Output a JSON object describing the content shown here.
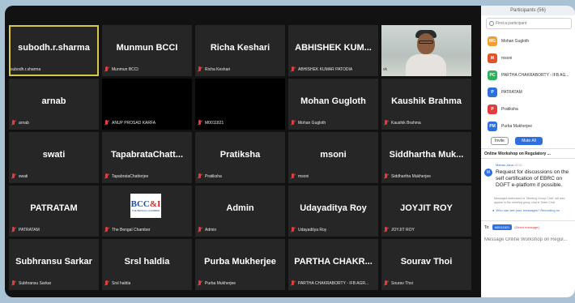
{
  "tiles": [
    {
      "big": "subodh.r.sharma",
      "foot": "subodh.r.sharma",
      "type": "name",
      "active": true,
      "mic": false
    },
    {
      "big": "Munmun BCCI",
      "foot": "Munmun BCCI",
      "type": "name",
      "mic": true
    },
    {
      "big": "Richa Keshari",
      "foot": "Richa Keshari",
      "type": "name",
      "mic": true
    },
    {
      "big": "ABHISHEK KUM...",
      "foot": "ABHISHEK KUMAR PATODIA",
      "type": "name",
      "mic": true
    },
    {
      "big": "",
      "foot": "",
      "type": "video",
      "mic": false
    },
    {
      "big": "arnab",
      "foot": "arnab",
      "type": "name",
      "mic": true
    },
    {
      "big": "",
      "foot": "ANUP PROSAD KARFA",
      "type": "off",
      "mic": true
    },
    {
      "big": "",
      "foot": "M0011821",
      "type": "off",
      "mic": true
    },
    {
      "big": "Mohan Gugloth",
      "foot": "Mohan Gugloth",
      "type": "name",
      "mic": true
    },
    {
      "big": "Kaushik Brahma",
      "foot": "Kaushik Brahma",
      "type": "name",
      "mic": true
    },
    {
      "big": "swati",
      "foot": "swati",
      "type": "name",
      "mic": true
    },
    {
      "big": "TapabrataChatt...",
      "foot": "TapabrataChatterjee",
      "type": "name",
      "mic": true
    },
    {
      "big": "Pratiksha",
      "foot": "Pratiksha",
      "type": "name",
      "mic": true
    },
    {
      "big": "msoni",
      "foot": "msoni",
      "type": "name",
      "mic": true
    },
    {
      "big": "Siddhartha Muk...",
      "foot": "Siddhartha Mukherjee",
      "type": "name",
      "mic": true
    },
    {
      "big": "PATRATAM",
      "foot": "PATRATAM",
      "type": "name",
      "mic": true
    },
    {
      "big": "",
      "foot": "The Bengal Chamber",
      "type": "logo",
      "mic": true
    },
    {
      "big": "Admin",
      "foot": "Admin",
      "type": "name",
      "mic": true
    },
    {
      "big": "Udayaditya Roy",
      "foot": "Udayaditya Roy",
      "type": "name",
      "mic": true
    },
    {
      "big": "JOYJIT ROY",
      "foot": "JOYJIT ROY",
      "type": "name",
      "mic": true
    },
    {
      "big": "Subhransu Sarkar",
      "foot": "Subhransu Sarkar",
      "type": "name",
      "mic": true
    },
    {
      "big": "Srsl haldia",
      "foot": "Srsl haldia",
      "type": "name",
      "mic": true
    },
    {
      "big": "Purba Mukherjee",
      "foot": "Purba Mukherjee",
      "type": "name",
      "mic": true
    },
    {
      "big": "PARTHA CHAKR...",
      "foot": "PARTHA CHAKRABORTY - IFB AGR...",
      "type": "name",
      "mic": true
    },
    {
      "big": "Sourav Thoi",
      "foot": "Sourav Thoi",
      "type": "name",
      "mic": true
    }
  ],
  "video_tile_label": "vk",
  "logo": {
    "text_main": "BCC",
    "text_accent": "&I",
    "sub": "THE BENGAL CHAMBER"
  },
  "panel": {
    "title": "Participants (56)",
    "search_placeholder": "Find a participant",
    "participants": [
      {
        "initials": "MG",
        "name": "Mohan Gugloth",
        "color": "#f0a030"
      },
      {
        "initials": "M",
        "name": "msoni",
        "color": "#e0522a"
      },
      {
        "initials": "PC",
        "name": "PARTHA CHAKRABORTY - IFB AG...",
        "color": "#2fb35a"
      },
      {
        "initials": "P",
        "name": "PATRATAM",
        "color": "#2d6fe0"
      },
      {
        "initials": "P",
        "name": "Pratiksha",
        "color": "#e23c3c"
      },
      {
        "initials": "PM",
        "name": "Purba Mukherjee",
        "color": "#2d6fe0"
      }
    ],
    "invite_label": "Invite",
    "mute_all_label": "Mute All",
    "chat_title": "Online Workshop on Regulatory ...",
    "message": {
      "avatar": "M",
      "sender": "Manas.Jana",
      "time": "10:41",
      "text": "Request for discussions on the self certification of EBRC on DGFT e-platform if possible."
    },
    "note": "Messages addressed to \"Meeting Group Chat\" will also appear in the meeting group chat in Team Chat",
    "who_can_see": "Who can see your messages? Recording on",
    "to_label": "To:",
    "to_chip": "M0011821",
    "direct_label": "(Direct message)",
    "input_placeholder": "Message Online Workshop on Regul..."
  }
}
